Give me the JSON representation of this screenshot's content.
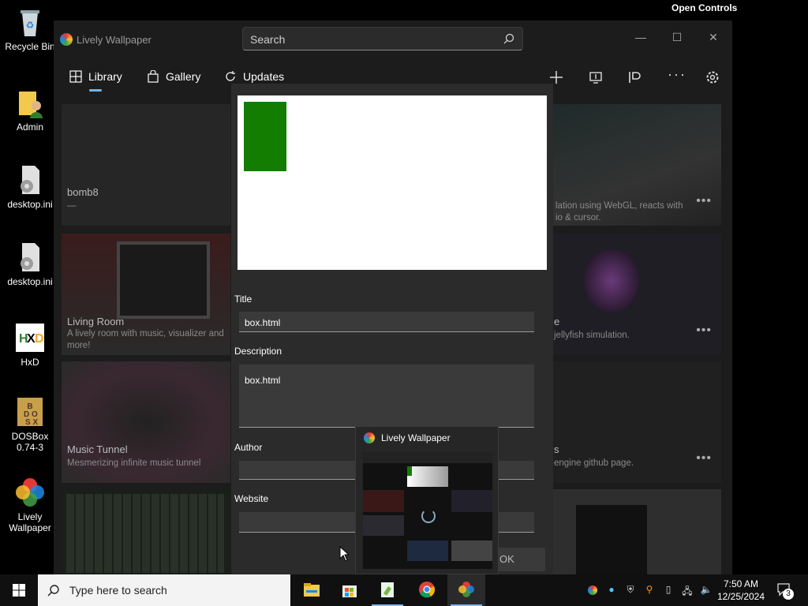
{
  "desktop": {
    "open_controls": "Open Controls",
    "icons": [
      {
        "label": "Recycle Bin"
      },
      {
        "label": "Admin"
      },
      {
        "label": "desktop.ini"
      },
      {
        "label": "desktop.ini"
      },
      {
        "label": "HxD"
      },
      {
        "label": "DOSBox\n0.74-3"
      },
      {
        "label": "Lively\nWallpaper"
      }
    ]
  },
  "window": {
    "title": "Lively Wallpaper",
    "search_placeholder": "Search",
    "nav": {
      "library": "Library",
      "gallery": "Gallery",
      "updates": "Updates"
    }
  },
  "cards": [
    {
      "title": "bomb8",
      "desc": "—"
    },
    {
      "title": "",
      "desc": "lation using WebGL, reacts with\nio & cursor."
    },
    {
      "title": "Living Room",
      "desc": "A lively room with music, visualizer and\nmore!"
    },
    {
      "title": "e",
      "desc": "jellyfish simulation."
    },
    {
      "title": "Music Tunnel",
      "desc": "Mesmerizing infinite music tunnel"
    },
    {
      "title": "s",
      "desc": "engine github page."
    }
  ],
  "dialog": {
    "title_label": "Title",
    "title_value": "box.html",
    "description_label": "Description",
    "description_value": "box.html",
    "author_label": "Author",
    "author_value": "",
    "website_label": "Website",
    "website_value": "",
    "ok_label": "OK"
  },
  "taskbar_preview": {
    "title": "Lively Wallpaper"
  },
  "taskbar": {
    "search_placeholder": "Type here to search",
    "time": "7:50 AM",
    "date": "12/25/2024",
    "notification_count": "3"
  }
}
